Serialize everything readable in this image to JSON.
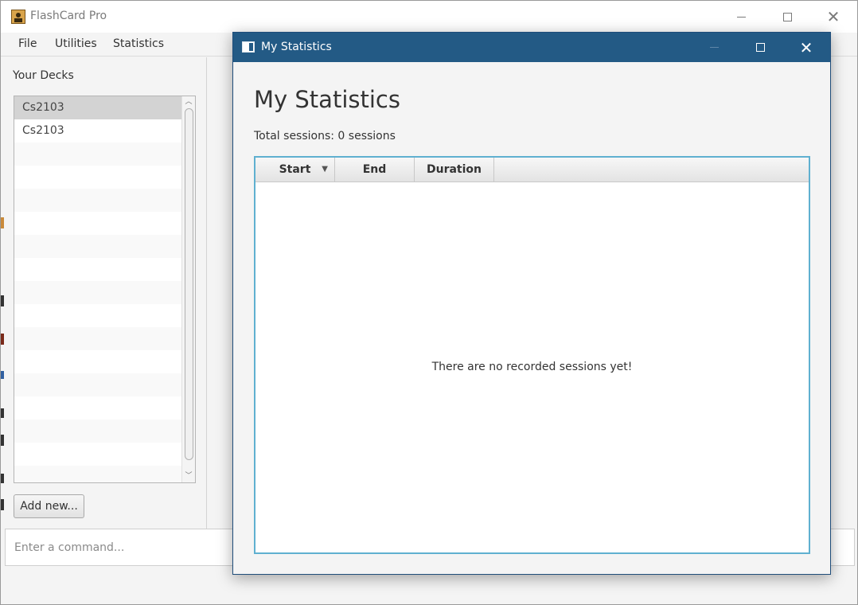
{
  "app": {
    "title": "FlashCard Pro",
    "menu": [
      "File",
      "Utilities",
      "Statistics"
    ]
  },
  "sidebar": {
    "title": "Your Decks",
    "decks": [
      "Cs2103",
      "Cs2103"
    ],
    "add_button": "Add new..."
  },
  "command": {
    "placeholder": "Enter a command..."
  },
  "dialog": {
    "window_title": "My Statistics",
    "heading": "My Statistics",
    "total_sessions": "Total sessions: 0 sessions",
    "columns": [
      "Start",
      "End",
      "Duration"
    ],
    "sort_indicator": "▼",
    "empty_message": "There are no recorded sessions yet!"
  },
  "colors": {
    "dialog_titlebar": "#235a85",
    "table_focus_border": "#5fb0d0",
    "selected_row": "#d3d3d3"
  }
}
